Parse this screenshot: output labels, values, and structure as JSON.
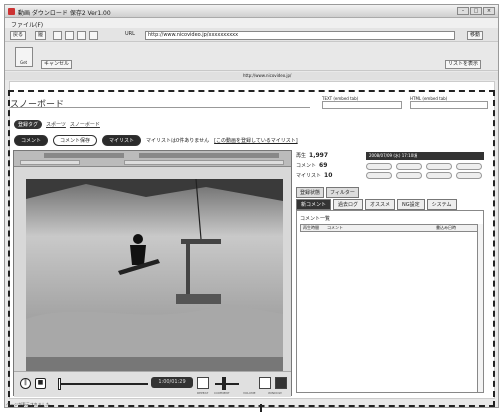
{
  "window": {
    "title": "動画 ダウンロード 保存2 Ver1.00",
    "min": "–",
    "max": "□",
    "close": "×"
  },
  "menu": {
    "file": "ファイル(F)"
  },
  "toolbar": {
    "back_label": "戻る",
    "hist_label": "履",
    "url_label": "URL",
    "url_value": "http://www.nicovideo.jp/xxxxxxxxxx",
    "go_label": "移動"
  },
  "toolbar2": {
    "get_label": "Get",
    "cancel_label": "キャンセル",
    "list_label": "リストを表示"
  },
  "statusstrip": {
    "url": "http://www.nicovideo.jp/"
  },
  "page": {
    "title": "スノーボード",
    "text_embed_label": "TEXT (embed tab)",
    "html_embed_label": "HTML (embed tab)",
    "tags": {
      "pill": "登録タグ",
      "links": [
        "スポーツ",
        "スノーボード"
      ]
    },
    "buttons": {
      "comment": "コメント",
      "comment_save": "コメント保存",
      "mylist": "マイリスト",
      "mylist_note": "マイリストは0件ありません",
      "mylist_link": "[この動画を登録しているマイリスト]"
    }
  },
  "player": {
    "time": "1:00/01:29",
    "control_labels": [
      "REPEAT",
      "COMMENT",
      "VOLUME",
      "WINDOW"
    ]
  },
  "stats": {
    "views_label": "再生",
    "views": "1,997",
    "comments_label": "コメント",
    "comments": "69",
    "mylist_label": "マイリスト",
    "mylist": "10",
    "date": "2008/07/09 (水) 17:10頃"
  },
  "side": {
    "tabs_top": [
      "登録状態",
      "フィルター"
    ],
    "tabs": [
      "新コメント",
      "過去ログ",
      "オススメ",
      "NG設定",
      "システム"
    ],
    "comment_list_title": "コメント一覧",
    "col_time": "再生時間",
    "col_comment": "コメント",
    "col_date": "書込み日時"
  },
  "statusbar": {
    "text": "ページが表示されました"
  }
}
